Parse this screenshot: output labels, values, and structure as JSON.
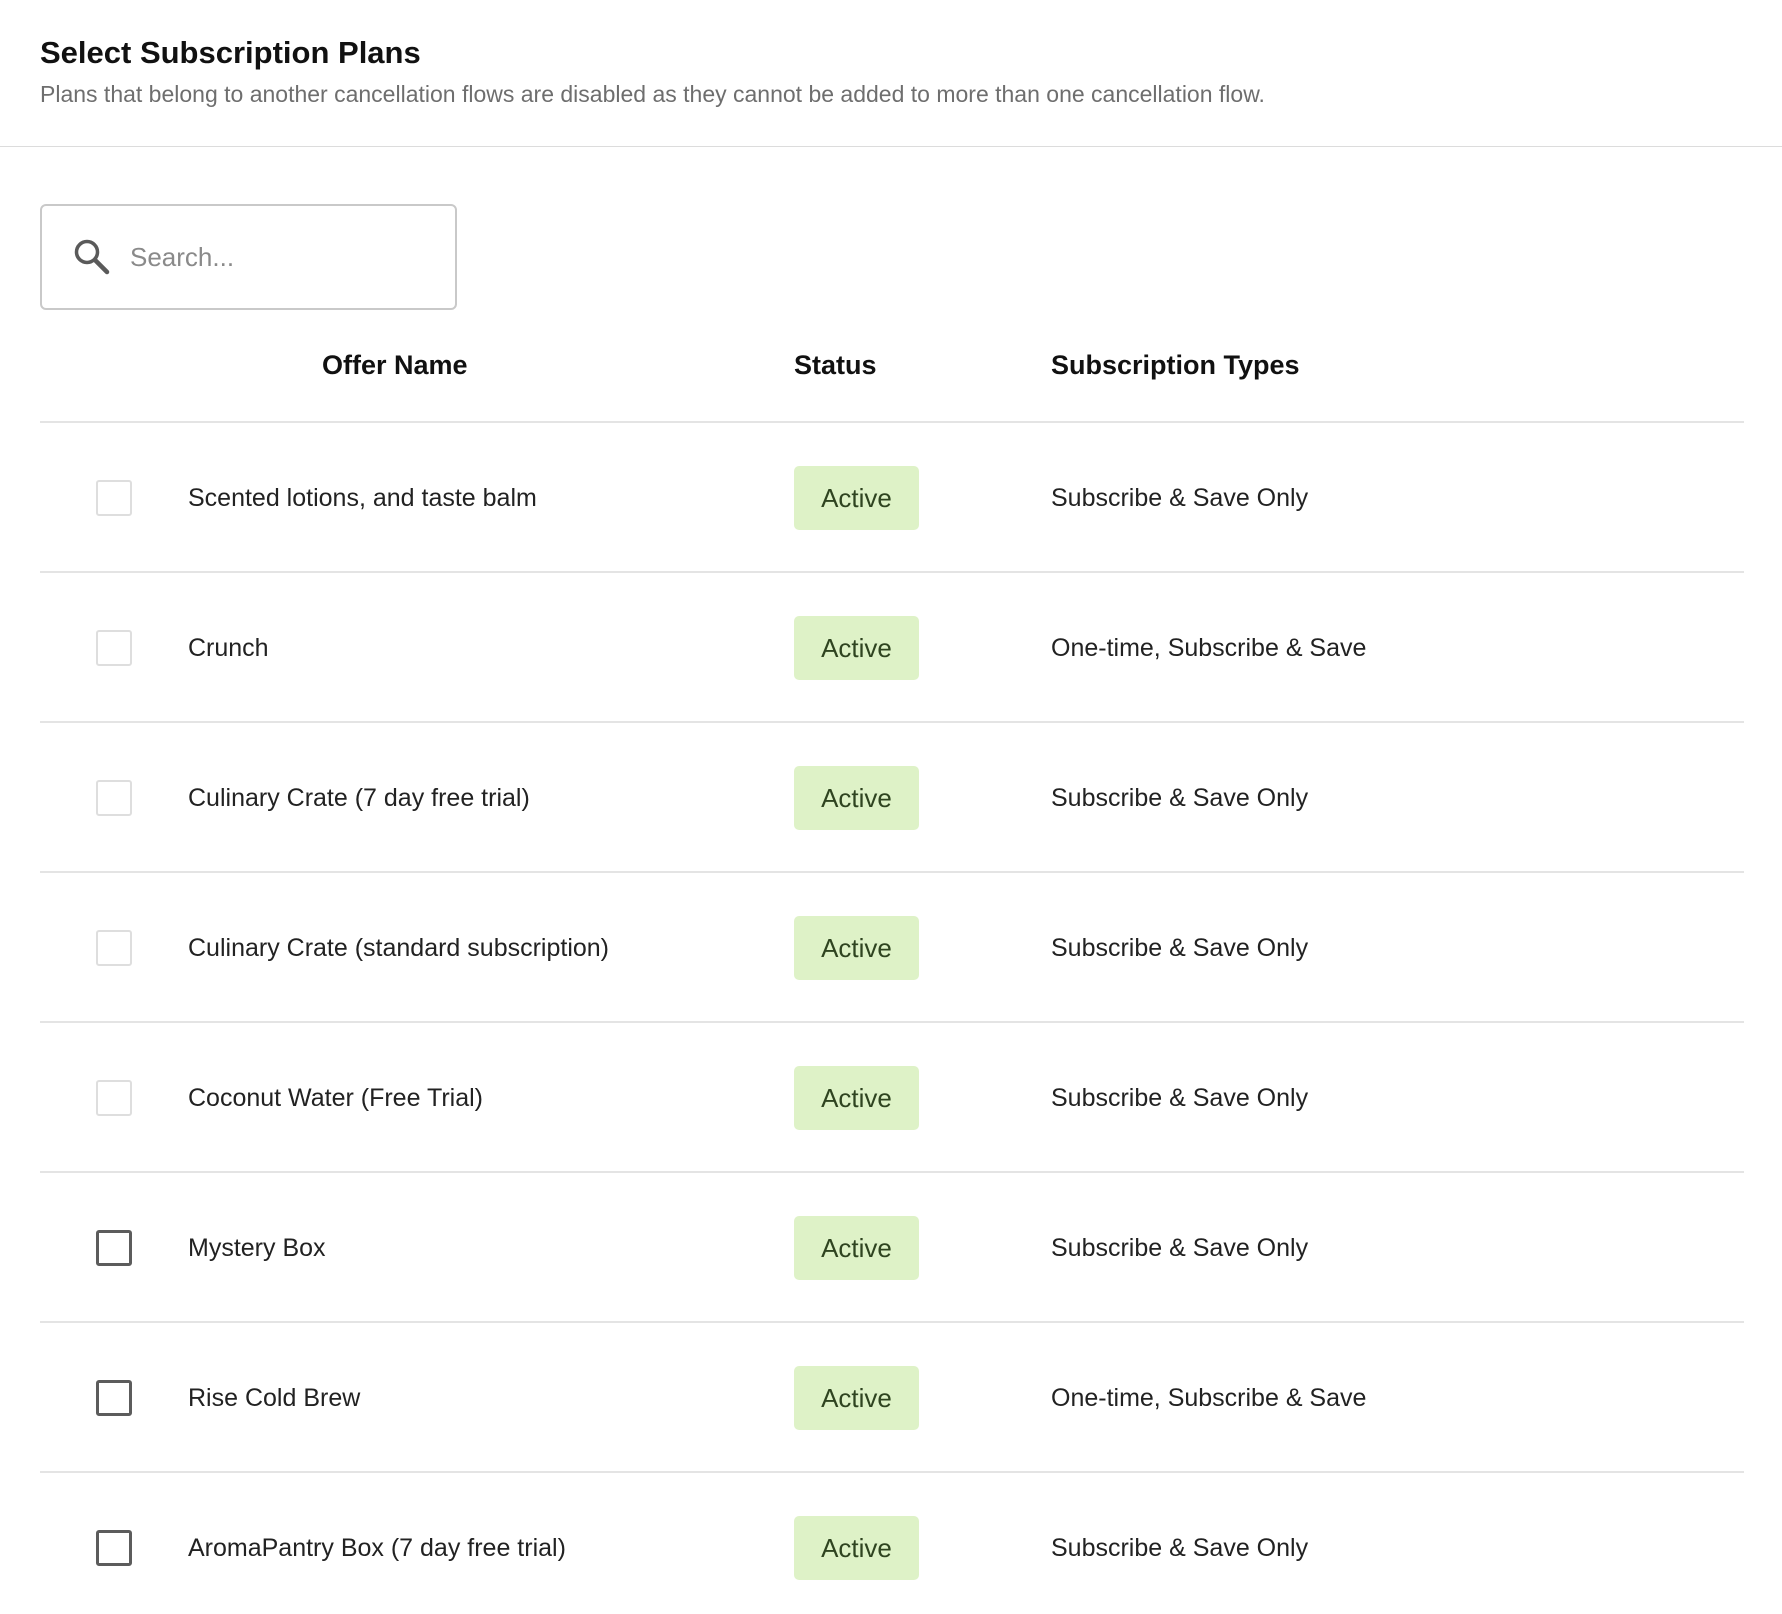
{
  "header": {
    "title": "Select Subscription Plans",
    "subtitle": "Plans that belong to another cancellation flows are disabled as they cannot be added to more than one cancellation flow."
  },
  "search": {
    "placeholder": "Search...",
    "value": "",
    "icon": "search-icon"
  },
  "table": {
    "columns": [
      "Offer Name",
      "Status",
      "Subscription Types"
    ],
    "rows": [
      {
        "name": "Scented lotions, and taste balm",
        "status": "Active",
        "types": "Subscribe & Save Only",
        "selectable": false,
        "checked": false
      },
      {
        "name": "Crunch",
        "status": "Active",
        "types": "One-time, Subscribe & Save",
        "selectable": false,
        "checked": false
      },
      {
        "name": "Culinary Crate (7 day free trial)",
        "status": "Active",
        "types": "Subscribe & Save Only",
        "selectable": false,
        "checked": false
      },
      {
        "name": "Culinary Crate (standard subscription)",
        "status": "Active",
        "types": "Subscribe & Save Only",
        "selectable": false,
        "checked": false
      },
      {
        "name": "Coconut Water (Free Trial)",
        "status": "Active",
        "types": "Subscribe & Save Only",
        "selectable": false,
        "checked": false
      },
      {
        "name": "Mystery Box",
        "status": "Active",
        "types": "Subscribe & Save Only",
        "selectable": true,
        "checked": false
      },
      {
        "name": "Rise Cold Brew",
        "status": "Active",
        "types": "One-time, Subscribe & Save",
        "selectable": true,
        "checked": false
      },
      {
        "name": "AromaPantry Box (7 day free trial)",
        "status": "Active",
        "types": "Subscribe & Save Only",
        "selectable": true,
        "checked": false
      }
    ]
  },
  "colors": {
    "active_badge_bg": "#def2c7",
    "active_badge_text": "#2f4420",
    "disabled_checkbox_border": "#dedede",
    "enabled_checkbox_border": "#5c5c5c"
  }
}
